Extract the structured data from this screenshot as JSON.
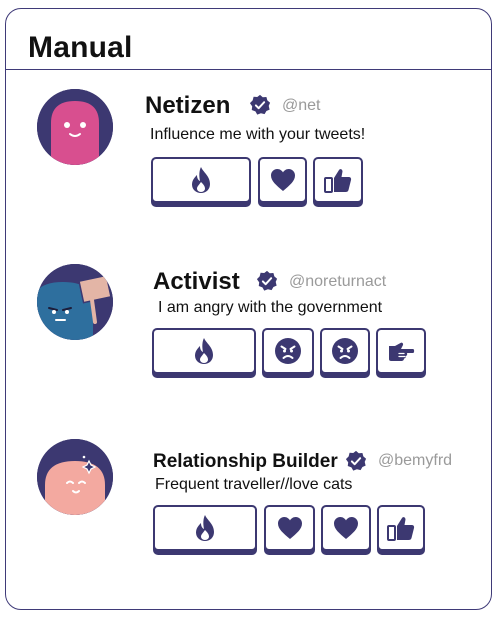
{
  "card": {
    "title": "Manual"
  },
  "colors": {
    "accent": "#3c3871",
    "handle": "#9a9a9a"
  },
  "profiles": [
    {
      "name": "Netizen",
      "handle": "@net",
      "bio": "Influence me with your tweets!",
      "verified_icon": "verified-badge-icon",
      "avatar_color": "#d84f8f",
      "reactions": [
        "fire-icon",
        "heart-icon",
        "thumbs-up-icon"
      ]
    },
    {
      "name": "Activist",
      "handle": "@noreturnact",
      "bio": "I am angry with the government",
      "verified_icon": "verified-badge-icon",
      "avatar_color": "#2e6f9e",
      "reactions": [
        "fire-icon",
        "angry-face-icon",
        "angry-face-icon",
        "pointing-hand-icon"
      ]
    },
    {
      "name": "Relationship Builder",
      "handle": "@bemyfrd",
      "bio": "Frequent traveller//love cats",
      "verified_icon": "verified-badge-icon",
      "avatar_color": "#f3a9a0",
      "reactions": [
        "fire-icon",
        "heart-icon",
        "heart-icon",
        "thumbs-up-icon"
      ]
    }
  ]
}
